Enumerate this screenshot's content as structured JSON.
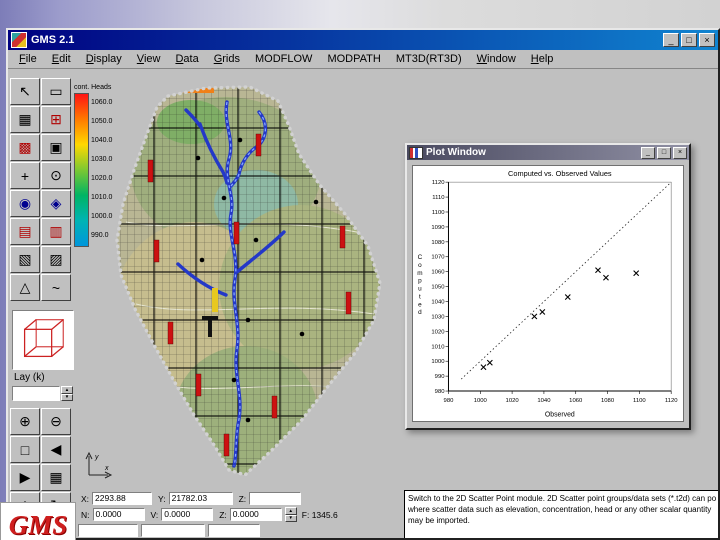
{
  "slide": {
    "logo_text": "GMS"
  },
  "window": {
    "title": "GMS 2.1",
    "controls": {
      "minimize": "_",
      "maximize": "□",
      "close": "×"
    }
  },
  "menu": {
    "items": [
      {
        "label": "File",
        "u": 0
      },
      {
        "label": "Edit",
        "u": 0
      },
      {
        "label": "Display",
        "u": 0
      },
      {
        "label": "View",
        "u": 0
      },
      {
        "label": "Data",
        "u": 0
      },
      {
        "label": "Grids",
        "u": 0
      },
      {
        "label": "MODFLOW",
        "u": -1
      },
      {
        "label": "MODPATH",
        "u": -1
      },
      {
        "label": "MT3D(RT3D)",
        "u": -1
      },
      {
        "label": "Window",
        "u": 0
      },
      {
        "label": "Help",
        "u": 0
      }
    ]
  },
  "legend": {
    "title": "cont. Heads",
    "labels": [
      "1060.0",
      "1050.0",
      "1040.0",
      "1030.0",
      "1020.0",
      "1010.0",
      "1000.0",
      "990.0"
    ],
    "ramp_colors": [
      "#ff1414",
      "#ff7a00",
      "#ffd800",
      "#7cc832",
      "#00b464",
      "#00b4b4",
      "#0096dc"
    ]
  },
  "tool_palette": {
    "layer_label": "Lay (k)",
    "layer_value": "",
    "top": [
      {
        "name": "select-tool",
        "glyph": "↖",
        "color": "#000000"
      },
      {
        "name": "select-box-tool",
        "glyph": "▭",
        "color": "#000000"
      },
      {
        "name": "grid-frame-tool",
        "glyph": "▦",
        "color": "#000000"
      },
      {
        "name": "create-grid-tool",
        "glyph": "⊞",
        "color": "#b00000"
      },
      {
        "name": "mesh-tool",
        "glyph": "▩",
        "color": "#b00000"
      },
      {
        "name": "region-select-tool",
        "glyph": "▣",
        "color": "#000000"
      },
      {
        "name": "pan-tool",
        "glyph": "+",
        "color": "#000000"
      },
      {
        "name": "zoom-tool",
        "glyph": "⊙",
        "color": "#000000"
      },
      {
        "name": "node-select-tool",
        "glyph": "◉",
        "color": "#000090"
      },
      {
        "name": "element-select-tool",
        "glyph": "◈",
        "color": "#000090"
      },
      {
        "name": "row-select-tool",
        "glyph": "▤",
        "color": "#b00000"
      },
      {
        "name": "column-select-tool",
        "glyph": "▥",
        "color": "#b00000"
      },
      {
        "name": "cell-fill-tool",
        "glyph": "▧",
        "color": "#000000"
      },
      {
        "name": "cell-hatch-tool",
        "glyph": "▨",
        "color": "#000000"
      },
      {
        "name": "polygon-tool",
        "glyph": "△",
        "color": "#000000"
      },
      {
        "name": "arc-tool",
        "glyph": "~",
        "color": "#000000"
      }
    ],
    "bottom": [
      {
        "name": "zoom-in-tool",
        "glyph": "⊕",
        "color": "#000000"
      },
      {
        "name": "zoom-out-tool",
        "glyph": "⊖",
        "color": "#000000"
      },
      {
        "name": "frame-view-tool",
        "glyph": "□",
        "color": "#000000"
      },
      {
        "name": "previous-view-tool",
        "glyph": "◀",
        "color": "#000000"
      },
      {
        "name": "next-view-tool",
        "glyph": "▶",
        "color": "#000000"
      },
      {
        "name": "plan-view-tool",
        "glyph": "▦",
        "color": "#000000"
      },
      {
        "name": "oblique-view-tool",
        "glyph": "◇",
        "color": "#000000"
      },
      {
        "name": "rotate-view-tool",
        "glyph": "↻",
        "color": "#000000"
      },
      {
        "name": "shade-tool",
        "glyph": "▲",
        "color": "#b00000"
      },
      {
        "name": "wireframe-tool",
        "glyph": "▽",
        "color": "#000000"
      }
    ]
  },
  "map": {
    "axis_x": "x",
    "axis_y": "y"
  },
  "plot_window": {
    "title": "Plot Window",
    "controls": [
      "_",
      "□",
      "×"
    ]
  },
  "chart_data": {
    "type": "scatter",
    "title": "Computed vs. Observed Values",
    "xlabel": "Observed",
    "ylabel": "Computed",
    "xlim": [
      980,
      1120
    ],
    "ylim": [
      980,
      1120
    ],
    "x_ticks": [
      980,
      1000,
      1020,
      1040,
      1060,
      1080,
      1100,
      1120
    ],
    "y_ticks": [
      980,
      990,
      1000,
      1010,
      1020,
      1030,
      1040,
      1050,
      1060,
      1070,
      1080,
      1090,
      1100,
      1110,
      1120
    ],
    "points": [
      {
        "x": 1002,
        "y": 996
      },
      {
        "x": 1006,
        "y": 999
      },
      {
        "x": 1034,
        "y": 1030
      },
      {
        "x": 1039,
        "y": 1033
      },
      {
        "x": 1055,
        "y": 1043
      },
      {
        "x": 1074,
        "y": 1061
      },
      {
        "x": 1079,
        "y": 1056
      },
      {
        "x": 1098,
        "y": 1059
      }
    ],
    "reference_line": {
      "from": [
        988,
        988
      ],
      "to": [
        1120,
        1120
      ],
      "style": "dotted"
    },
    "marker": "x",
    "legend_position": "none",
    "grid": false
  },
  "status": {
    "rows": [
      {
        "fields": [
          {
            "label": "X:",
            "value": "2293.88",
            "w": 54
          },
          {
            "label": "Y:",
            "value": "21782.03",
            "w": 58
          },
          {
            "label": "Z:",
            "value": "",
            "w": 46
          }
        ]
      },
      {
        "fields": [
          {
            "label": "N:",
            "value": "0.0000",
            "w": 46
          },
          {
            "label": "V:",
            "value": "0.0000",
            "w": 46
          },
          {
            "label": "Z:",
            "value": "0.0000",
            "w": 46
          }
        ],
        "spinner": true,
        "tail": {
          "label": "F:",
          "value": "1345.6"
        }
      },
      {
        "fields": [
          {
            "label": "",
            "value": "",
            "w": 54
          },
          {
            "label": "",
            "value": "",
            "w": 58
          },
          {
            "label": "",
            "value": "",
            "w": 46
          }
        ]
      }
    ],
    "help_lines": [
      "Switch to the 2D Scatter Point module. 2D Scatter point groups/data sets (*.t2d) can po",
      "where scatter data such as elevation, concentration, head or any other scalar quantity",
      "may be imported."
    ]
  },
  "colors": {
    "titlebar_from": "#000080",
    "titlebar_to": "#1084d0",
    "chrome": "#c0c0c0",
    "stream_blue": "#2438c8",
    "well_red": "#cc1111",
    "boundary_orange": "#f08018"
  }
}
